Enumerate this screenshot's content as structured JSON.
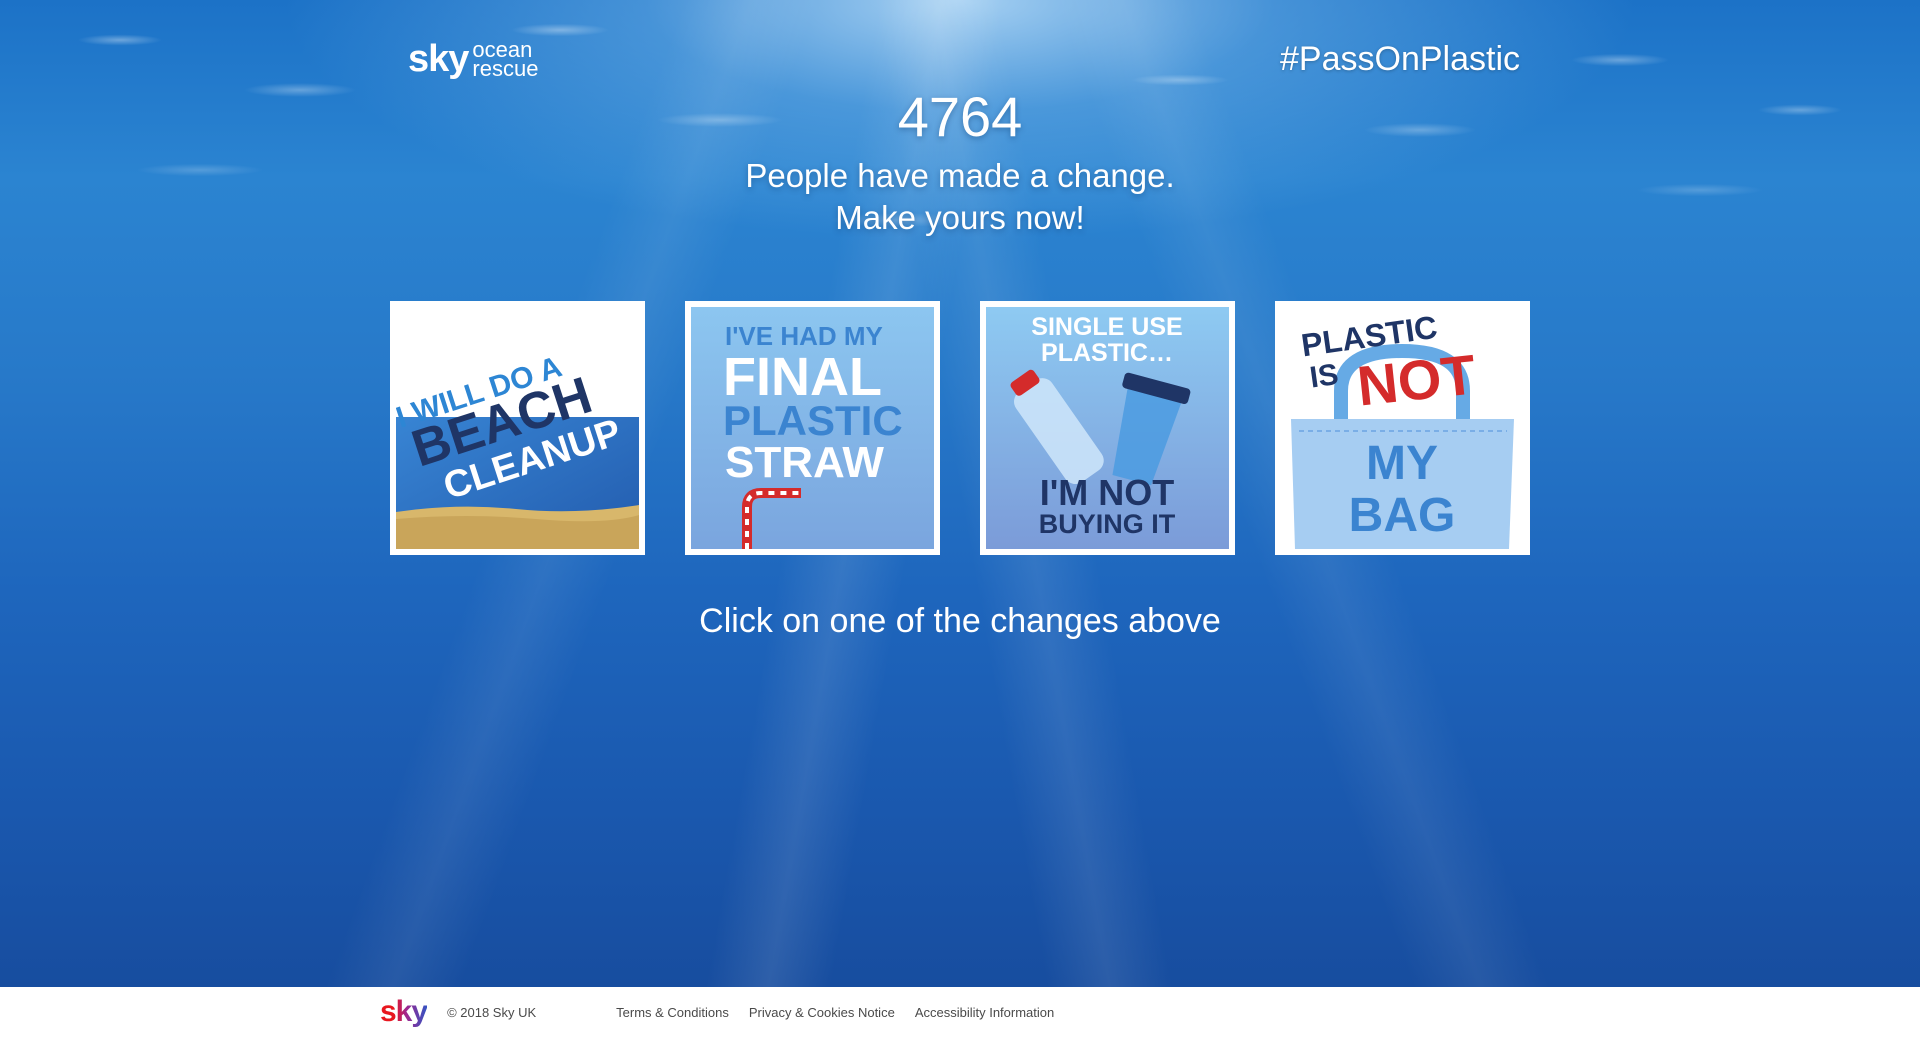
{
  "header": {
    "logo_sky": "sky",
    "logo_ocean": "ocean",
    "logo_rescue": "rescue",
    "hashtag": "#PassOnPlastic"
  },
  "hero": {
    "count": "4764",
    "line1": "People have made a change.",
    "line2": "Make yours now!"
  },
  "cards": [
    {
      "lines": [
        "I WILL DO A",
        "BEACH",
        "CLEANUP"
      ]
    },
    {
      "lines": [
        "I'VE HAD MY",
        "FINAL",
        "PLASTIC",
        "STRAW"
      ]
    },
    {
      "lines": [
        "SINGLE USE",
        "PLASTIC…",
        "I'M NOT",
        "BUYING IT"
      ]
    },
    {
      "lines": [
        "PLASTIC",
        "IS",
        "NOT",
        "MY",
        "BAG"
      ]
    }
  ],
  "prompt": "Click on one of the changes above",
  "footer": {
    "logo": "sky",
    "copyright": "© 2018 Sky UK",
    "links": [
      "Terms & Conditions",
      "Privacy & Cookies Notice",
      "Accessibility Information"
    ]
  },
  "colors": {
    "ocean_top": "#1c72c7",
    "ocean_bottom": "#174d9f",
    "card_navy": "#1f3566",
    "card_blue": "#3f8fd6",
    "card_red": "#d42b2b"
  }
}
